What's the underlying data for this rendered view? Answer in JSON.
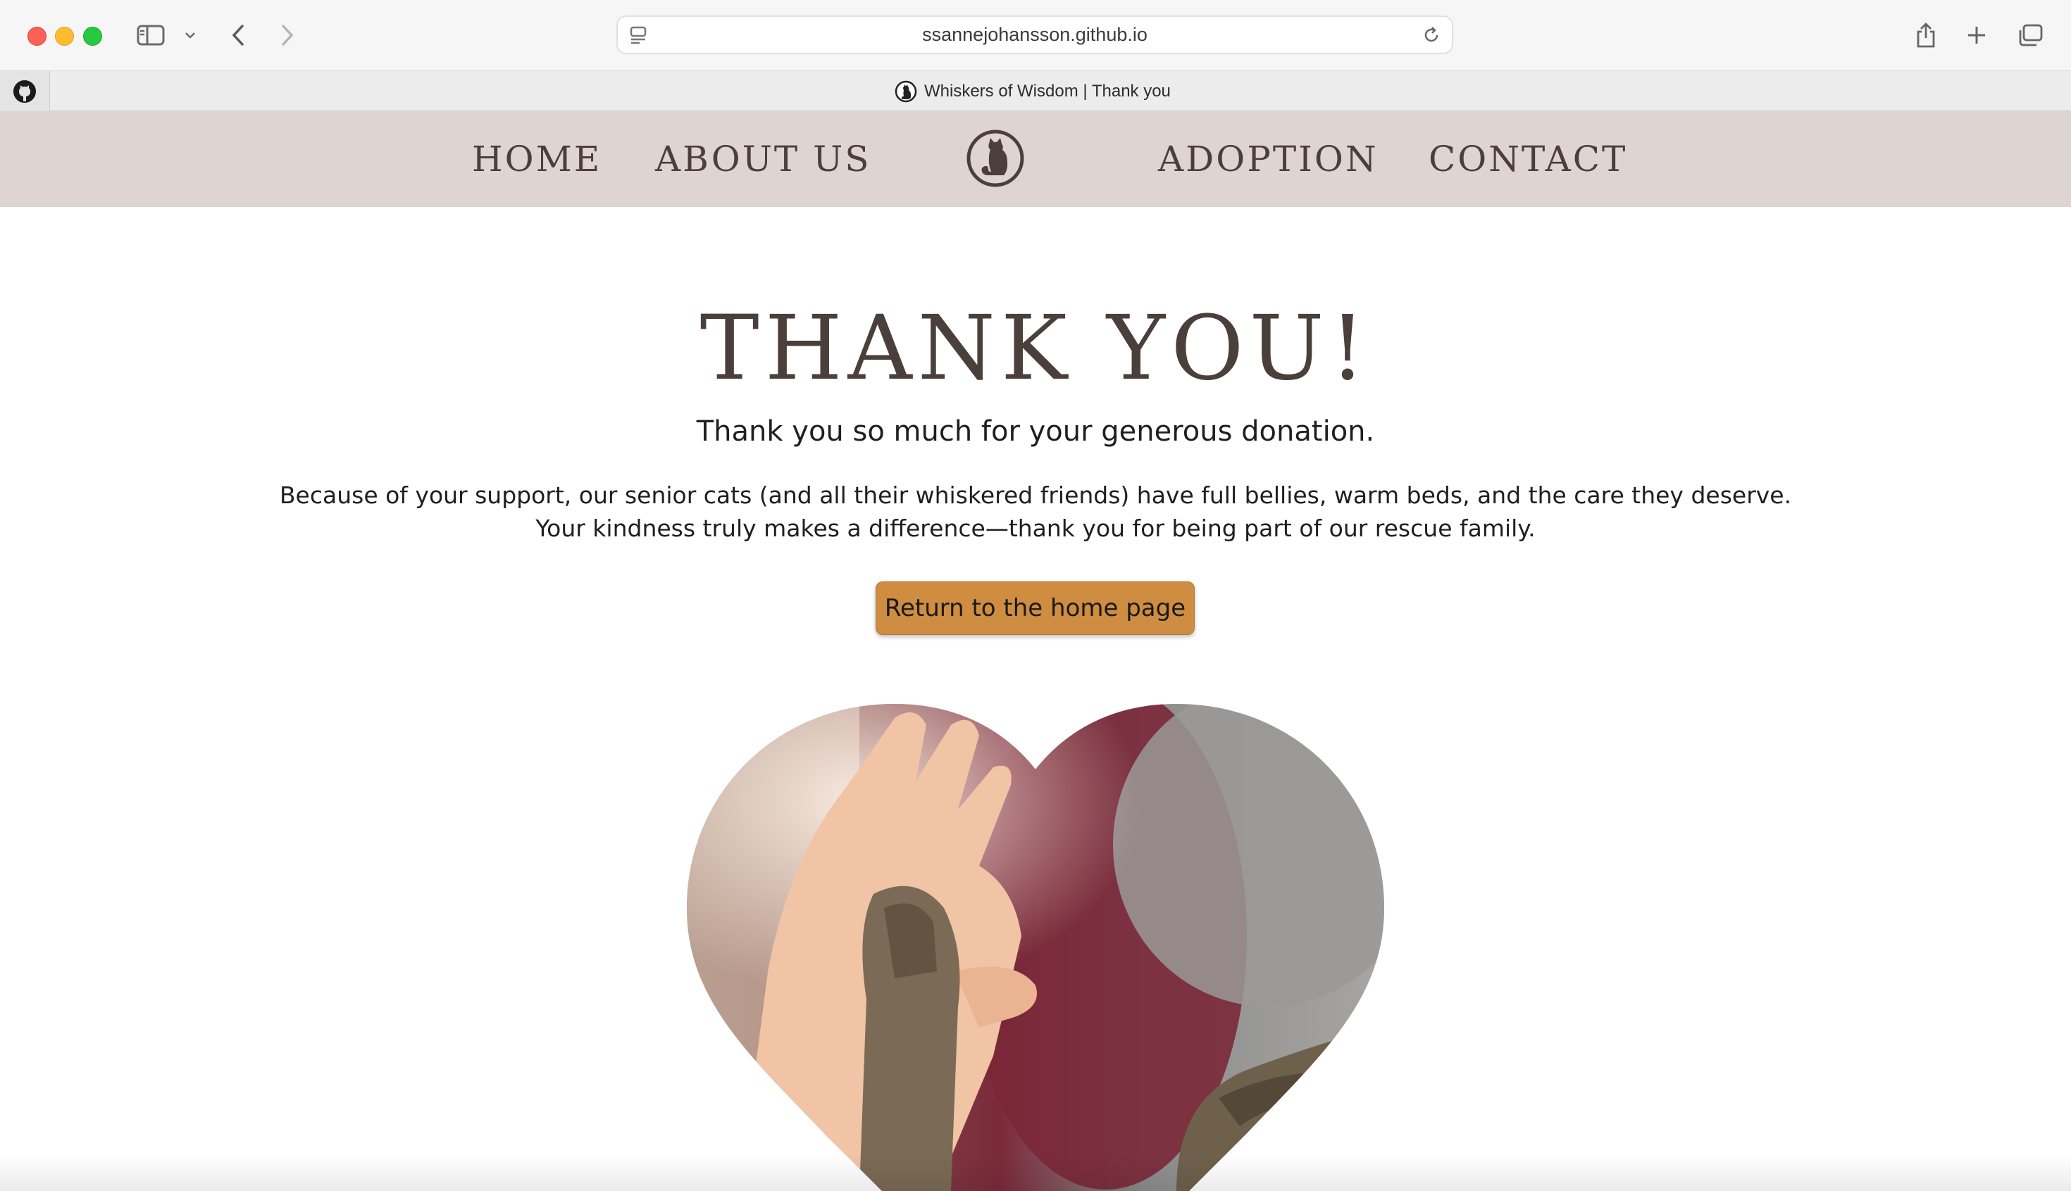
{
  "browser": {
    "url": "ssannejohansson.github.io",
    "tab_title": "Whiskers of Wisdom | Thank you",
    "icons": [
      "sidebar-icon",
      "chevron-down-icon",
      "back-arrow-icon",
      "forward-arrow-icon",
      "page-menu-icon",
      "reload-icon",
      "share-icon",
      "new-tab-plus-icon",
      "tab-overview-icon",
      "github-icon"
    ]
  },
  "nav": {
    "home": "HOME",
    "about": "ABOUT US",
    "adoption": "ADOPTION",
    "contact": "CONTACT",
    "logo_icon": "cat-logo-icon"
  },
  "main": {
    "title": "THANK YOU!",
    "subtitle": "Thank you so much for your generous donation.",
    "paragraph_line1": "Because of your support, our senior cats (and all their whiskered friends) have full bellies, warm beds, and the care they deserve.",
    "paragraph_line2": "Your kindness truly makes a difference—thank you for being part of our rescue family.",
    "button_label": "Return to the home page",
    "image": "heart-shaped photo of a human hand high-fiving a tabby cat paw"
  },
  "colors": {
    "nav_bg": "#ded4d2",
    "nav_text": "#4a3f3a",
    "button_bg": "#cf8d42",
    "body_text": "#1f1f1f"
  }
}
